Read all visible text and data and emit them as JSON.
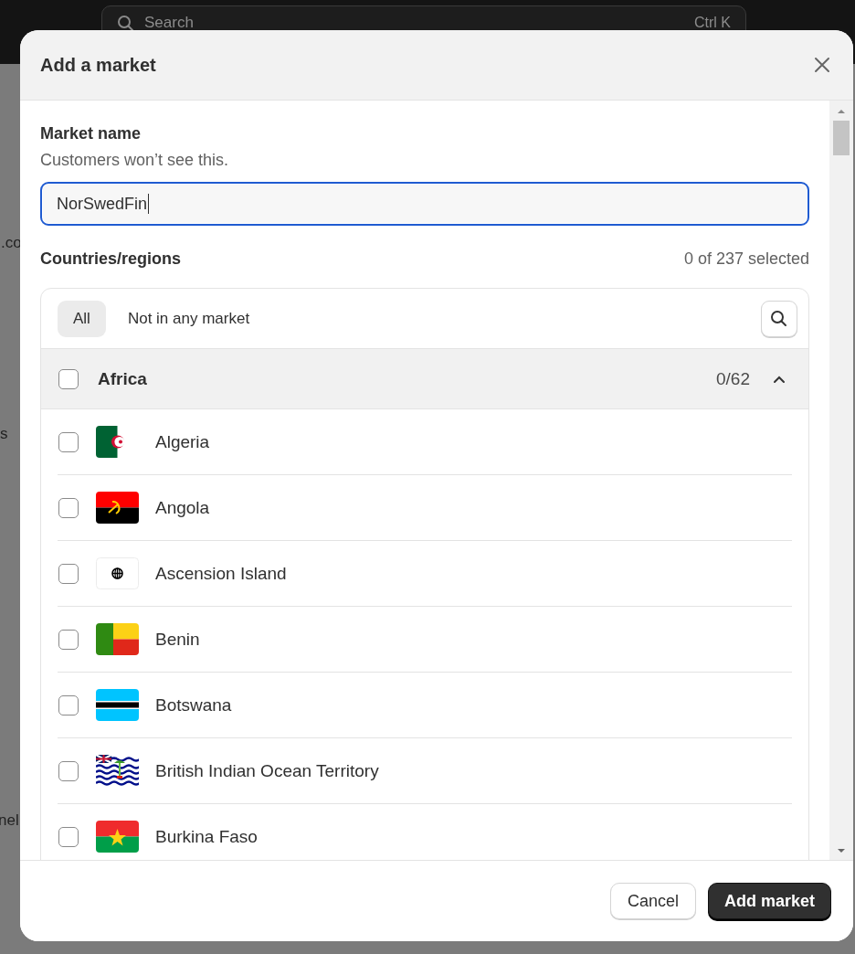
{
  "backdrop": {
    "search": {
      "placeholder": "Search",
      "shortcut": "Ctrl K"
    },
    "fragments": [
      ".co",
      "s",
      "nel"
    ]
  },
  "dialog": {
    "title": "Add a market",
    "market_name": {
      "label": "Market name",
      "help": "Customers won’t see this.",
      "value": "NorSwedFin"
    },
    "countries": {
      "label": "Countries/regions",
      "count": "0 of 237 selected",
      "tabs": [
        {
          "label": "All",
          "selected": true
        },
        {
          "label": "Not in any market",
          "selected": false
        }
      ],
      "groups": [
        {
          "name": "Africa",
          "count": "0/62",
          "checked": false,
          "expanded": true,
          "items": [
            {
              "name": "Algeria",
              "checked": false
            },
            {
              "name": "Angola",
              "checked": false
            },
            {
              "name": "Ascension Island",
              "checked": false
            },
            {
              "name": "Benin",
              "checked": false
            },
            {
              "name": "Botswana",
              "checked": false
            },
            {
              "name": "British Indian Ocean Territory",
              "checked": false
            },
            {
              "name": "Burkina Faso",
              "checked": false
            }
          ]
        }
      ]
    },
    "buttons": [
      {
        "label": "Cancel",
        "kind": "secondary"
      },
      {
        "label": "Add market",
        "kind": "primary"
      }
    ]
  }
}
